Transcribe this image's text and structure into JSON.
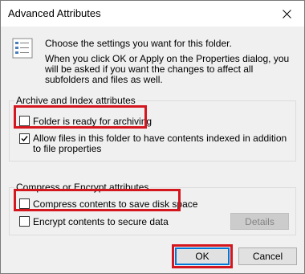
{
  "window": {
    "title": "Advanced Attributes",
    "close_icon": "close-icon"
  },
  "description": {
    "icon": "folder-settings-icon",
    "line1": "Choose the settings you want for this folder.",
    "line2": "When you click OK or Apply on the Properties dialog, you will be asked if you want the changes to affect all subfolders and files as well."
  },
  "archive_group": {
    "label": "Archive and Index attributes",
    "archiving": {
      "label": "Folder is ready for archiving",
      "checked": false
    },
    "indexing": {
      "label": "Allow files in this folder to have contents indexed in addition to file properties",
      "checked": true
    }
  },
  "compress_group": {
    "label": "Compress or Encrypt attributes",
    "compress": {
      "label": "Compress contents to save disk space",
      "checked": false
    },
    "encrypt": {
      "label": "Encrypt contents to secure data",
      "checked": false
    },
    "details_label": "Details"
  },
  "buttons": {
    "ok_label": "OK",
    "cancel_label": "Cancel"
  },
  "colors": {
    "highlight": "#d4161e",
    "accent": "#0078d7"
  }
}
